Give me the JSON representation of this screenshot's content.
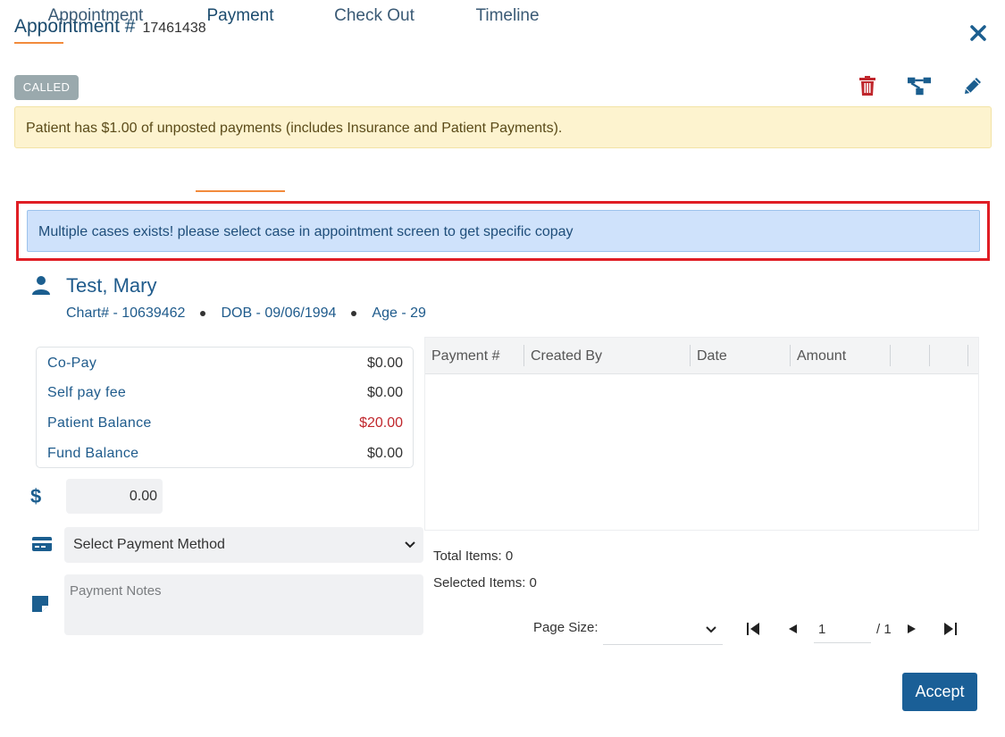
{
  "header": {
    "title": "Appointment #",
    "number": "17461438"
  },
  "status": "CALLED",
  "icons": {
    "close": "close-icon",
    "delete": "trash-icon",
    "hierarchy": "sitemap-icon",
    "edit": "pencil-icon"
  },
  "colors": {
    "accent": "#f28b3c",
    "primary": "#1a5f97",
    "danger": "#c0272d",
    "warning_bg": "#fdf3cf",
    "info_bg": "#cfe2fb",
    "highlight": "#e01e25"
  },
  "warning": "Patient has $1.00 of unposted payments (includes Insurance and Patient Payments).",
  "tabs": [
    {
      "label": "Appointment",
      "active": false
    },
    {
      "label": "Payment",
      "active": true
    },
    {
      "label": "Check Out",
      "active": false
    },
    {
      "label": "Timeline",
      "active": false
    }
  ],
  "info": "Multiple cases exists! please select case in appointment screen to get specific copay",
  "patient": {
    "name": "Test, Mary",
    "chart": "Chart# - 10639462",
    "dob": "DOB - 09/06/1994",
    "age": "Age - 29"
  },
  "balances": [
    {
      "label": "Co-Pay",
      "value": "$0.00"
    },
    {
      "label": "Self pay fee",
      "value": "$0.00"
    },
    {
      "label": "Patient Balance",
      "value": "$20.00"
    },
    {
      "label": "Fund Balance",
      "value": "$0.00"
    }
  ],
  "payment": {
    "amount": "0.00",
    "method": "Select Payment Method",
    "notes_placeholder": "Payment Notes"
  },
  "grid": {
    "columns": [
      "Payment #",
      "Created By",
      "Date",
      "Amount",
      "",
      ""
    ],
    "total_items": "Total Items: 0",
    "selected_items": "Selected Items: 0"
  },
  "pager": {
    "page_size_label": "Page Size:",
    "page_size": "",
    "current_page": "1",
    "total_pages": "/ 1"
  },
  "accept_label": "Accept"
}
